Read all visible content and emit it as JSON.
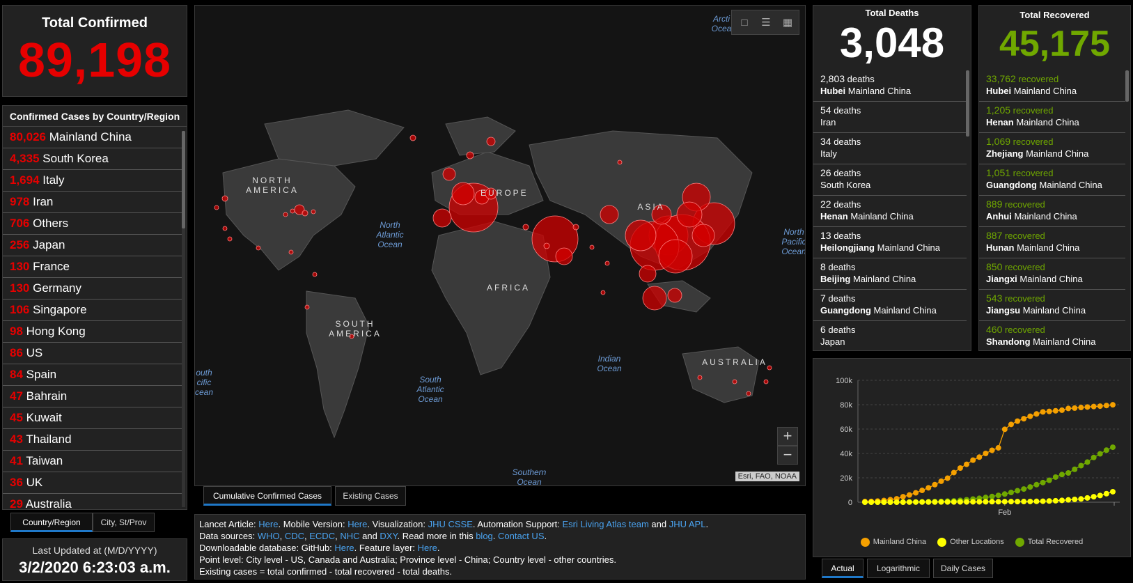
{
  "total_confirmed": {
    "title": "Total Confirmed",
    "value": "89,198"
  },
  "country_panel": {
    "title": "Confirmed Cases by Country/Region",
    "rows": [
      {
        "num": "80,026",
        "name": "Mainland China"
      },
      {
        "num": "4,335",
        "name": "South Korea"
      },
      {
        "num": "1,694",
        "name": "Italy"
      },
      {
        "num": "978",
        "name": "Iran"
      },
      {
        "num": "706",
        "name": "Others"
      },
      {
        "num": "256",
        "name": "Japan"
      },
      {
        "num": "130",
        "name": "France"
      },
      {
        "num": "130",
        "name": "Germany"
      },
      {
        "num": "106",
        "name": "Singapore"
      },
      {
        "num": "98",
        "name": "Hong Kong"
      },
      {
        "num": "86",
        "name": "US"
      },
      {
        "num": "84",
        "name": "Spain"
      },
      {
        "num": "47",
        "name": "Bahrain"
      },
      {
        "num": "45",
        "name": "Kuwait"
      },
      {
        "num": "43",
        "name": "Thailand"
      },
      {
        "num": "41",
        "name": "Taiwan"
      },
      {
        "num": "36",
        "name": "UK"
      },
      {
        "num": "29",
        "name": "Australia"
      }
    ],
    "tabs": [
      "Country/Region",
      "City, St/Prov"
    ]
  },
  "last_updated": {
    "label": "Last Updated at (M/D/YYYY)",
    "value": "3/2/2020 6:23:03 a.m."
  },
  "map": {
    "labels": {
      "north_america": "NORTH AMERICA",
      "europe": "EUROPE",
      "asia": "ASIA",
      "africa": "AFRICA",
      "south_america": "SOUTH AMERICA",
      "australia": "AUSTRALIA"
    },
    "oceans": {
      "north_atlantic": "North Atlantic Ocean",
      "south_atlantic": "South Atlantic Ocean",
      "indian": "Indian Ocean",
      "north_pacific": "North Pacific Ocean",
      "south_pacific": "outh cific cean",
      "southern": "Southern Ocean",
      "arctic": "Arcti Ocea"
    },
    "attribution": "Esri, FAO, NOAA",
    "zoom_in": "+",
    "zoom_out": "−",
    "tabs": [
      "Cumulative Confirmed Cases",
      "Existing Cases"
    ]
  },
  "info": {
    "line1": [
      {
        "t": "Lancet Article: "
      },
      {
        "t": "Here",
        "link": true
      },
      {
        "t": ". Mobile Version: "
      },
      {
        "t": "Here",
        "link": true
      },
      {
        "t": ". Visualization: "
      },
      {
        "t": "JHU CSSE",
        "link": true
      },
      {
        "t": ". Automation Support: "
      },
      {
        "t": "Esri Living Atlas team",
        "link": true
      },
      {
        "t": " and "
      },
      {
        "t": "JHU APL",
        "link": true
      },
      {
        "t": "."
      }
    ],
    "line2": [
      {
        "t": "Data sources: "
      },
      {
        "t": "WHO",
        "link": true
      },
      {
        "t": ", "
      },
      {
        "t": "CDC",
        "link": true
      },
      {
        "t": ", "
      },
      {
        "t": "ECDC",
        "link": true
      },
      {
        "t": ", "
      },
      {
        "t": "NHC",
        "link": true
      },
      {
        "t": " and "
      },
      {
        "t": "DXY",
        "link": true
      },
      {
        "t": ". Read more in this "
      },
      {
        "t": "blog",
        "link": true
      },
      {
        "t": ". "
      },
      {
        "t": "Contact US",
        "link": true
      },
      {
        "t": "."
      }
    ],
    "line3": [
      {
        "t": "Downloadable database: GitHub: "
      },
      {
        "t": "Here",
        "link": true
      },
      {
        "t": ". Feature layer: "
      },
      {
        "t": "Here",
        "link": true
      },
      {
        "t": "."
      }
    ],
    "line4": [
      {
        "t": "Point level: City level - US, Canada and Australia; Province level - China; Country level - other countries."
      }
    ],
    "line5": [
      {
        "t": "Existing cases = total confirmed - total recovered - total deaths."
      }
    ]
  },
  "deaths": {
    "title": "Total Deaths",
    "value": "3,048",
    "rows": [
      {
        "n": "2,803",
        "unit": "deaths",
        "region": "Hubei",
        "country": "Mainland China"
      },
      {
        "n": "54",
        "unit": "deaths",
        "region": "",
        "country": "Iran"
      },
      {
        "n": "34",
        "unit": "deaths",
        "region": "",
        "country": "Italy"
      },
      {
        "n": "26",
        "unit": "deaths",
        "region": "",
        "country": "South Korea"
      },
      {
        "n": "22",
        "unit": "deaths",
        "region": "Henan",
        "country": "Mainland China"
      },
      {
        "n": "13",
        "unit": "deaths",
        "region": "Heilongjiang",
        "country": "Mainland China"
      },
      {
        "n": "8",
        "unit": "deaths",
        "region": "Beijing",
        "country": "Mainland China"
      },
      {
        "n": "7",
        "unit": "deaths",
        "region": "Guangdong",
        "country": "Mainland China"
      },
      {
        "n": "6",
        "unit": "deaths",
        "region": "",
        "country": "Japan"
      }
    ]
  },
  "recovered": {
    "title": "Total Recovered",
    "value": "45,175",
    "rows": [
      {
        "n": "33,762",
        "unit": "recovered",
        "region": "Hubei",
        "country": "Mainland China"
      },
      {
        "n": "1,205",
        "unit": "recovered",
        "region": "Henan",
        "country": "Mainland China"
      },
      {
        "n": "1,069",
        "unit": "recovered",
        "region": "Zhejiang",
        "country": "Mainland China"
      },
      {
        "n": "1,051",
        "unit": "recovered",
        "region": "Guangdong",
        "country": "Mainland China"
      },
      {
        "n": "889",
        "unit": "recovered",
        "region": "Anhui",
        "country": "Mainland China"
      },
      {
        "n": "887",
        "unit": "recovered",
        "region": "Hunan",
        "country": "Mainland China"
      },
      {
        "n": "850",
        "unit": "recovered",
        "region": "Jiangxi",
        "country": "Mainland China"
      },
      {
        "n": "543",
        "unit": "recovered",
        "region": "Jiangsu",
        "country": "Mainland China"
      },
      {
        "n": "460",
        "unit": "recovered",
        "region": "Shandong",
        "country": "Mainland China"
      }
    ]
  },
  "chart_tabs": [
    "Actual",
    "Logarithmic",
    "Daily Cases"
  ],
  "colors": {
    "confirmed": "#e60000",
    "recovered": "#70a800",
    "mainland": "#f5a000",
    "other": "#ffff00",
    "link": "#4aa3f0"
  },
  "chart_data": {
    "type": "line",
    "x": [
      1,
      2,
      3,
      4,
      5,
      6,
      7,
      8,
      9,
      10,
      11,
      12,
      13,
      14,
      15,
      16,
      17,
      18,
      19,
      20,
      21,
      22,
      23,
      24,
      25,
      26,
      27,
      28,
      29,
      30,
      31,
      32,
      33,
      34,
      35,
      36,
      37,
      38,
      39,
      40
    ],
    "xtick_labels": [
      "Feb"
    ],
    "yticks": [
      "0",
      "20k",
      "40k",
      "60k",
      "80k",
      "100k"
    ],
    "ylim": [
      0,
      100000
    ],
    "legend_placement": "bottom",
    "series": [
      {
        "name": "Mainland China",
        "color": "#f5a000",
        "values": [
          550,
          640,
          920,
          1400,
          2100,
          2800,
          4500,
          5900,
          7700,
          9700,
          11800,
          14400,
          17200,
          19700,
          24300,
          28000,
          31100,
          34500,
          37000,
          40000,
          42600,
          44600,
          59800,
          63800,
          66500,
          68500,
          70500,
          72400,
          74100,
          74500,
          75000,
          75500,
          76900,
          77200,
          77700,
          78100,
          78500,
          78800,
          79300,
          79900
        ]
      },
      {
        "name": "Other Locations",
        "color": "#ffff00",
        "values": [
          0,
          0,
          0,
          0,
          0,
          0,
          0,
          100,
          100,
          150,
          150,
          150,
          200,
          200,
          200,
          250,
          250,
          300,
          300,
          350,
          400,
          400,
          450,
          500,
          500,
          550,
          600,
          700,
          800,
          1000,
          1200,
          1500,
          1900,
          2300,
          2700,
          3500,
          4500,
          5500,
          7000,
          8600
        ]
      },
      {
        "name": "Total Recovered",
        "color": "#70a800",
        "values": [
          30,
          30,
          40,
          50,
          60,
          100,
          120,
          200,
          250,
          300,
          400,
          500,
          650,
          900,
          1100,
          1500,
          2000,
          2600,
          3200,
          3900,
          4700,
          5600,
          6700,
          8000,
          9400,
          10800,
          12500,
          14400,
          16100,
          18000,
          20600,
          22700,
          24000,
          27000,
          30000,
          32900,
          36700,
          39700,
          42700,
          45100
        ]
      }
    ]
  }
}
